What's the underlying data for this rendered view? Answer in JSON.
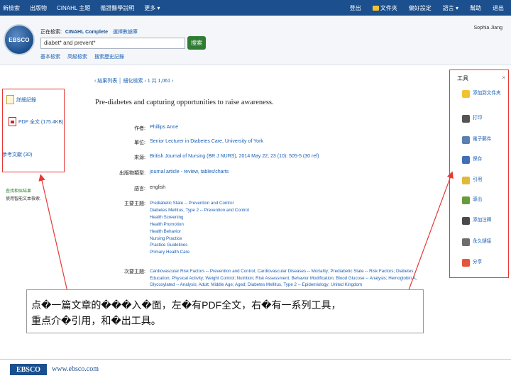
{
  "topnav": {
    "items": [
      "新檢索",
      "出版物",
      "CINAHL 主題",
      "循證醫學說明",
      "更多 ▾"
    ],
    "right": [
      "登出",
      "文件夾",
      "偏好設定",
      "語言 ▾",
      "幫助",
      "退出"
    ]
  },
  "header": {
    "logo": "EBSCO",
    "searching_label": "正在檢索:",
    "database": "CINAHL Complete",
    "choose_db": "選擇數據庫",
    "query": "diabet* and prevent*",
    "clear": "×",
    "search_button": "搜索",
    "links": [
      "基本檢索",
      "高級檢索",
      "搜索歷史記錄"
    ],
    "user": "Sophia Jiang"
  },
  "left_panel": {
    "items": [
      {
        "label": "詳細記錄",
        "icon": "detailed-record-icon"
      },
      {
        "label": "PDF 全文 (175.4KB)",
        "icon": "pdf-icon"
      },
      {
        "label": "參考文獻 (30)",
        "icon": "references-icon"
      }
    ],
    "related_title": "查找相似結果",
    "related_sub": "使用智能文本檢索."
  },
  "result_nav": "‹ 結果列表 │ 細化檢索 ‹ 1 共 1,061 ›",
  "article": {
    "title": "Pre-diabetes and capturing opportunities to raise awareness.",
    "fields": [
      {
        "label": "作者:",
        "value": "Phillips Anne"
      },
      {
        "label": "單位:",
        "value": "Senior Lecturer in Diabetes Care, University of York"
      },
      {
        "label": "來源:",
        "value": "British Journal of Nursing (BR J NURS), 2014 May 22; 23 (10): 505-5 (30 ref)"
      },
      {
        "label": "出版物類型:",
        "value": "journal article - review, tables/charts"
      },
      {
        "label": "語言:",
        "value": "english"
      }
    ],
    "subjects_label": "主要主題:",
    "subjects": [
      "Prediabetic State -- Prevention and Control",
      "Diabetes Mellitus, Type 2 -- Prevention and Control",
      "Health Screening",
      "Health Promotion",
      "Health Behavior",
      "Nursing Practice",
      "Practice Guidelines",
      "Primary Health Care"
    ],
    "minor_label": "次要主題:",
    "minor": "Cardiovascular Risk Factors -- Prevention and Control; Cardiovascular Diseases -- Mortality; Prediabetic State -- Risk Factors; Diabetes Education; Physical Activity; Weight Control; Nutrition; Risk Assessment; Behavior Modification; Blood Glucose -- Analysis; Hemoglobin A, Glycosylated -- Analysis; Adult; Middle Age; Aged; Diabetes Mellitus, Type 2 -- Epidemiology; United Kingdom"
  },
  "tools": {
    "title": "工具",
    "close": "×",
    "items": [
      {
        "label": "添加到文件夾",
        "icon": "add-folder-icon",
        "color": "#f2c230"
      },
      {
        "label": "打印",
        "icon": "print-icon",
        "color": "#555555"
      },
      {
        "label": "電子郵件",
        "icon": "email-icon",
        "color": "#5b7fb0"
      },
      {
        "label": "保存",
        "icon": "save-icon",
        "color": "#3f6fb5"
      },
      {
        "label": "引用",
        "icon": "cite-icon",
        "color": "#e0b83a"
      },
      {
        "label": "導出",
        "icon": "export-icon",
        "color": "#6a9a3a"
      },
      {
        "label": "添加注釋",
        "icon": "note-icon",
        "color": "#4a4a4a"
      },
      {
        "label": "永久鏈接",
        "icon": "permalink-icon",
        "color": "#6d6d6d"
      },
      {
        "label": "分享",
        "icon": "share-icon",
        "color": "#e5553a"
      }
    ]
  },
  "caption": {
    "line1": "点�一篇文章的���入�面，左�有PDF全文，右�有一系列工具，",
    "line2": "重点介�引用，和�出工具。"
  },
  "footer": {
    "logo": "EBSCO",
    "url": "www.ebsco.com"
  }
}
